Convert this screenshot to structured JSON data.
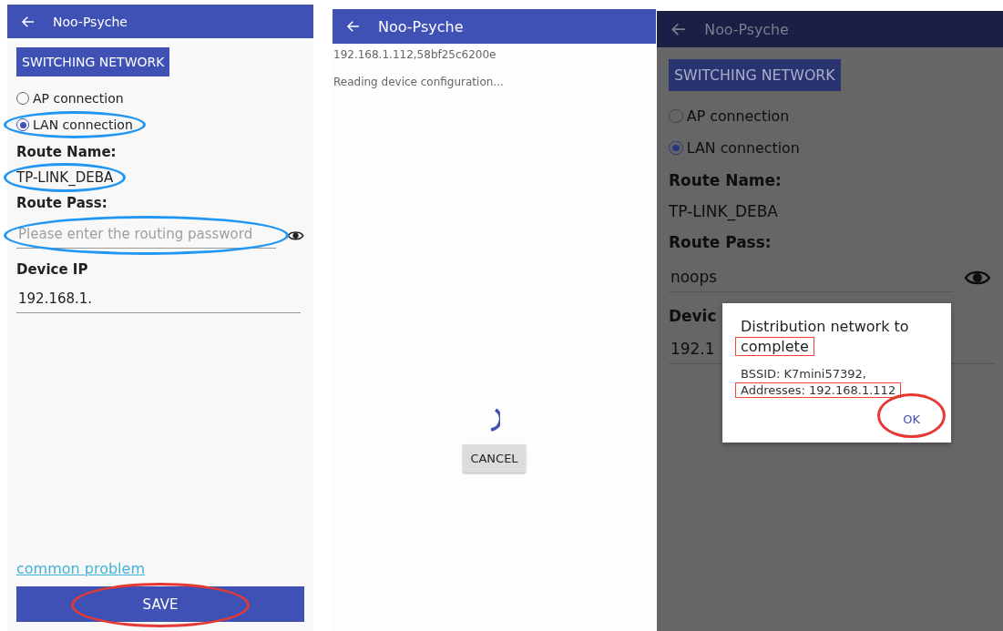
{
  "screens": [
    {
      "kind": "form",
      "dimmed": false,
      "app_bar": {
        "title": "Noo-Psyche"
      },
      "switch_button": "SWITCHING NETWORK",
      "radios": [
        {
          "label": "AP connection",
          "selected": false
        },
        {
          "label": "LAN connection",
          "selected": true,
          "annotation": {
            "kind": "ellipse",
            "color": "#2196f3"
          }
        }
      ],
      "route_name_label": "Route Name:",
      "route_name": {
        "value": "TP-LINK_DEBA",
        "annotation": {
          "kind": "ellipse",
          "color": "#2196f3"
        }
      },
      "route_pass_label": "Route Pass:",
      "route_pass": {
        "placeholder": "Please enter the routing password",
        "annotation": {
          "kind": "ellipse",
          "color": "#2196f3"
        }
      },
      "device_ip_label": "Device IP",
      "device_ip": {
        "value": "192.168.1."
      },
      "help_link": "common problem",
      "save_button": {
        "label": "SAVE",
        "annotation": {
          "kind": "ellipse",
          "color": "#e53935"
        }
      }
    },
    {
      "kind": "loading",
      "app_bar": {
        "title": "Noo-Psyche"
      },
      "lines": [
        "192.168.1.112,58bf25c6200e",
        "Reading device configuration..."
      ],
      "cancel_button": "CANCEL"
    },
    {
      "kind": "form",
      "dimmed": true,
      "app_bar": {
        "title": "Noo-Psyche"
      },
      "switch_button": "SWITCHING NETWORK",
      "radios": [
        {
          "label": "AP connection",
          "selected": false
        },
        {
          "label": "LAN connection",
          "selected": true
        }
      ],
      "route_name_label": "Route Name:",
      "route_name": {
        "value": "TP-LINK_DEBA"
      },
      "route_pass_label": "Route Pass:",
      "route_pass": {
        "value": "noops"
      },
      "device_ip_label": "Devic",
      "device_ip": {
        "value": "192.1"
      },
      "dialog": {
        "title_lines": [
          {
            "text": "Distribution network to"
          },
          {
            "text": "complete",
            "annotation": {
              "kind": "rectangle",
              "color": "#f44336"
            }
          }
        ],
        "message_lines": [
          {
            "text": "BSSID: K7mini57392,"
          },
          {
            "text": "Addresses: 192.168.1.112",
            "annotation": {
              "kind": "rectangle",
              "color": "#f44336"
            }
          }
        ],
        "ok_button": {
          "label": "OK",
          "annotation": {
            "kind": "ellipse",
            "color": "#e53935"
          }
        }
      }
    }
  ]
}
